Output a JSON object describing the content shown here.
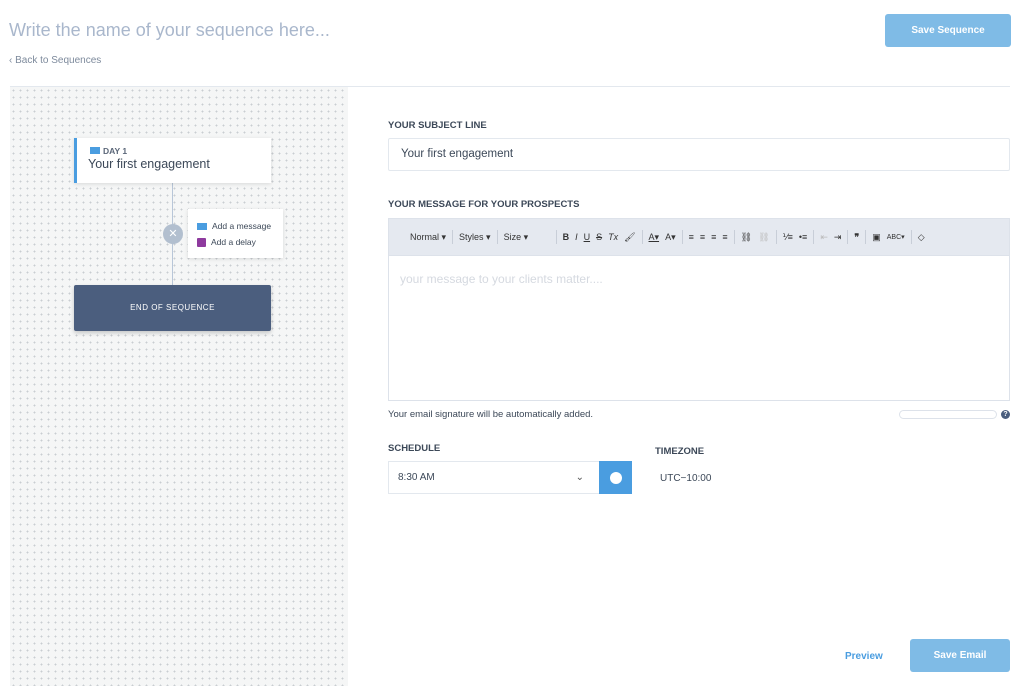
{
  "header": {
    "title_placeholder": "Write the name of your sequence here...",
    "back_link": "Back to Sequences",
    "save_sequence": "Save Sequence"
  },
  "flow": {
    "step": {
      "day": "DAY 1",
      "title": "Your first engagement"
    },
    "menu": {
      "add_message": "Add a message",
      "add_delay": "Add a delay"
    },
    "end": "END OF SEQUENCE"
  },
  "form": {
    "subject_label": "YOUR SUBJECT LINE",
    "subject_value": "Your first engagement",
    "message_label": "YOUR MESSAGE FOR YOUR PROSPECTS",
    "toolbar": {
      "format": "Normal ▾",
      "styles": "Styles ▾",
      "size": "Size ▾",
      "bold": "B",
      "italic": "I",
      "underline": "U",
      "strike": "S",
      "clear": "Tx",
      "brush": "🖌",
      "text_color": "A▾",
      "bg_color": "A▾",
      "align_left": "≡",
      "align_center": "≡",
      "align_right": "≡",
      "justify": "≡",
      "link": "⛓",
      "unlink": "⛓",
      "ol": "⅟≡",
      "ul": "•≡",
      "outdent": "⇤",
      "indent": "⇥",
      "quote": "❞",
      "image": "▣",
      "spell": "ABC▾",
      "tag": "◇"
    },
    "message_placeholder": "your message to your clients matter....",
    "signature_note": "Your email signature will be automatically added.",
    "help": "?",
    "schedule_label": "SCHEDULE",
    "schedule_value": "8:30 AM",
    "timezone_label": "TIMEZONE",
    "timezone_value": "UTC−10:00"
  },
  "footer": {
    "preview": "Preview",
    "save_email": "Save Email"
  },
  "colors": {
    "accent": "#4a9de0",
    "button_disabled": "#7fbbe6",
    "end_node": "#4b5e7e",
    "delay_icon": "#8e3a9e"
  }
}
